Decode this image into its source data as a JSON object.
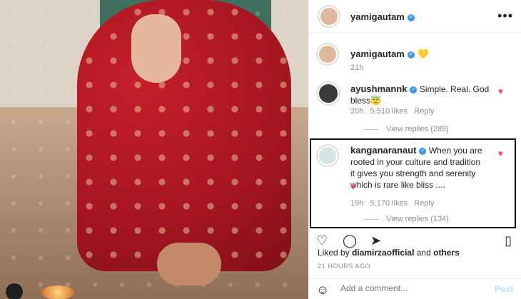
{
  "post": {
    "author": "yamigautam",
    "verified": "✓",
    "more_icon": "more-icon"
  },
  "comments": [
    {
      "username": "yamigautam",
      "emoji": "💛",
      "time": "21h"
    },
    {
      "username": "ayushmannk",
      "text": "Simple. Real. God bless😇",
      "time": "20h",
      "likes": "5,510 likes",
      "reply": "Reply",
      "view_replies": "View replies (289)"
    },
    {
      "username": "kanganaranaut",
      "text": "When you are rooted in your culture and tradition it gives you strength and serenity which is rare like bliss ....",
      "time": "19h",
      "likes": "5,170 likes",
      "reply": "Reply",
      "view_replies": "View replies (134)"
    }
  ],
  "actions": {
    "liked_by": "Liked by",
    "liked_by_user": "diamirzaofficial",
    "and": "and",
    "others": "others",
    "timestamp": "21 HOURS AGO"
  },
  "comment_bar": {
    "placeholder": "Add a comment...",
    "post": "Post"
  }
}
